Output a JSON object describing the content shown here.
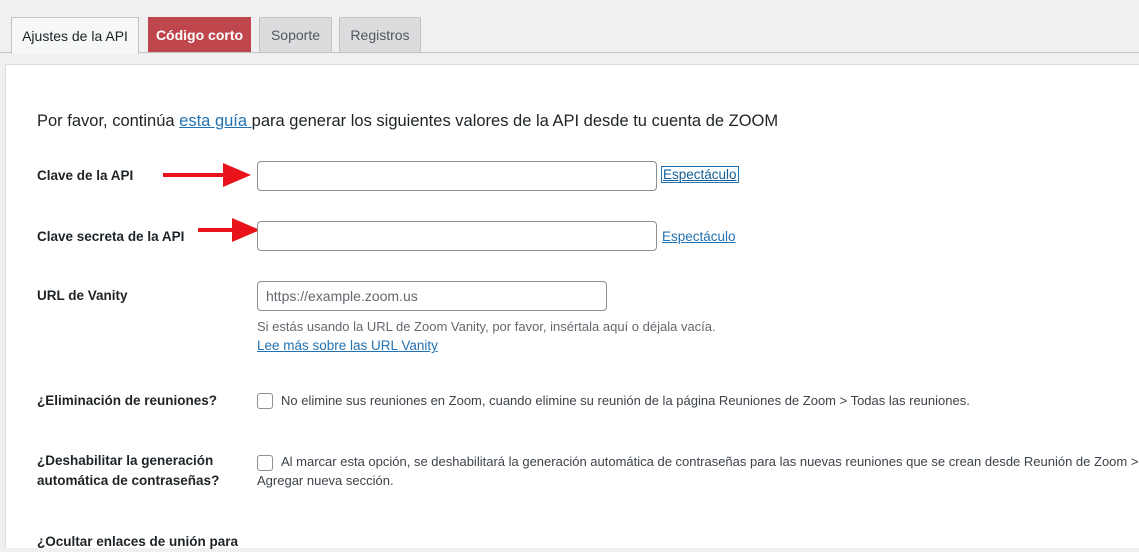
{
  "tabs": [
    {
      "label": "Ajustes de la API",
      "active": true
    },
    {
      "label": "Código corto",
      "active": false
    },
    {
      "label": "Soporte",
      "active": false
    },
    {
      "label": "Registros",
      "active": false
    }
  ],
  "intro": {
    "before": "Por favor, continúa ",
    "link": "esta guía ",
    "after": "para generar los siguientes valores de la API desde tu cuenta de ZOOM"
  },
  "fields": {
    "api_key": {
      "label": "Clave de la API",
      "value": "",
      "show_link": "Espectáculo"
    },
    "api_secret": {
      "label": "Clave secreta de la API",
      "value": "",
      "show_link": "Espectáculo"
    },
    "vanity": {
      "label": "URL de Vanity",
      "placeholder": "https://example.zoom.us",
      "description": "Si estás usando la URL de Zoom Vanity, por favor, insértala aquí o déjala vacía.",
      "more_link": "Lee más sobre las URL Vanity"
    },
    "delete_meetings": {
      "label": "¿Eliminación de reuniones?",
      "checked": false,
      "text": "No elimine sus reuniones en Zoom, cuando elimine su reunión de la página Reuniones de Zoom > Todas las reuniones."
    },
    "disable_passwords": {
      "label_line1": "¿Deshabilitar la generación",
      "label_line2": "automática de contraseñas?",
      "checked": false,
      "text_line1": "Al marcar esta opción, se deshabilitará la generación automática de contraseñas para las nuevas reuniones que se crean desde Reunión de Zoom >",
      "text_line2": "Agregar nueva sección."
    },
    "hide_join_links": {
      "label": "¿Ocultar enlaces de unión para"
    }
  },
  "colors": {
    "arrow": "#e8131b",
    "shortcode_tab": "#c0464e",
    "link": "#2271b1"
  }
}
